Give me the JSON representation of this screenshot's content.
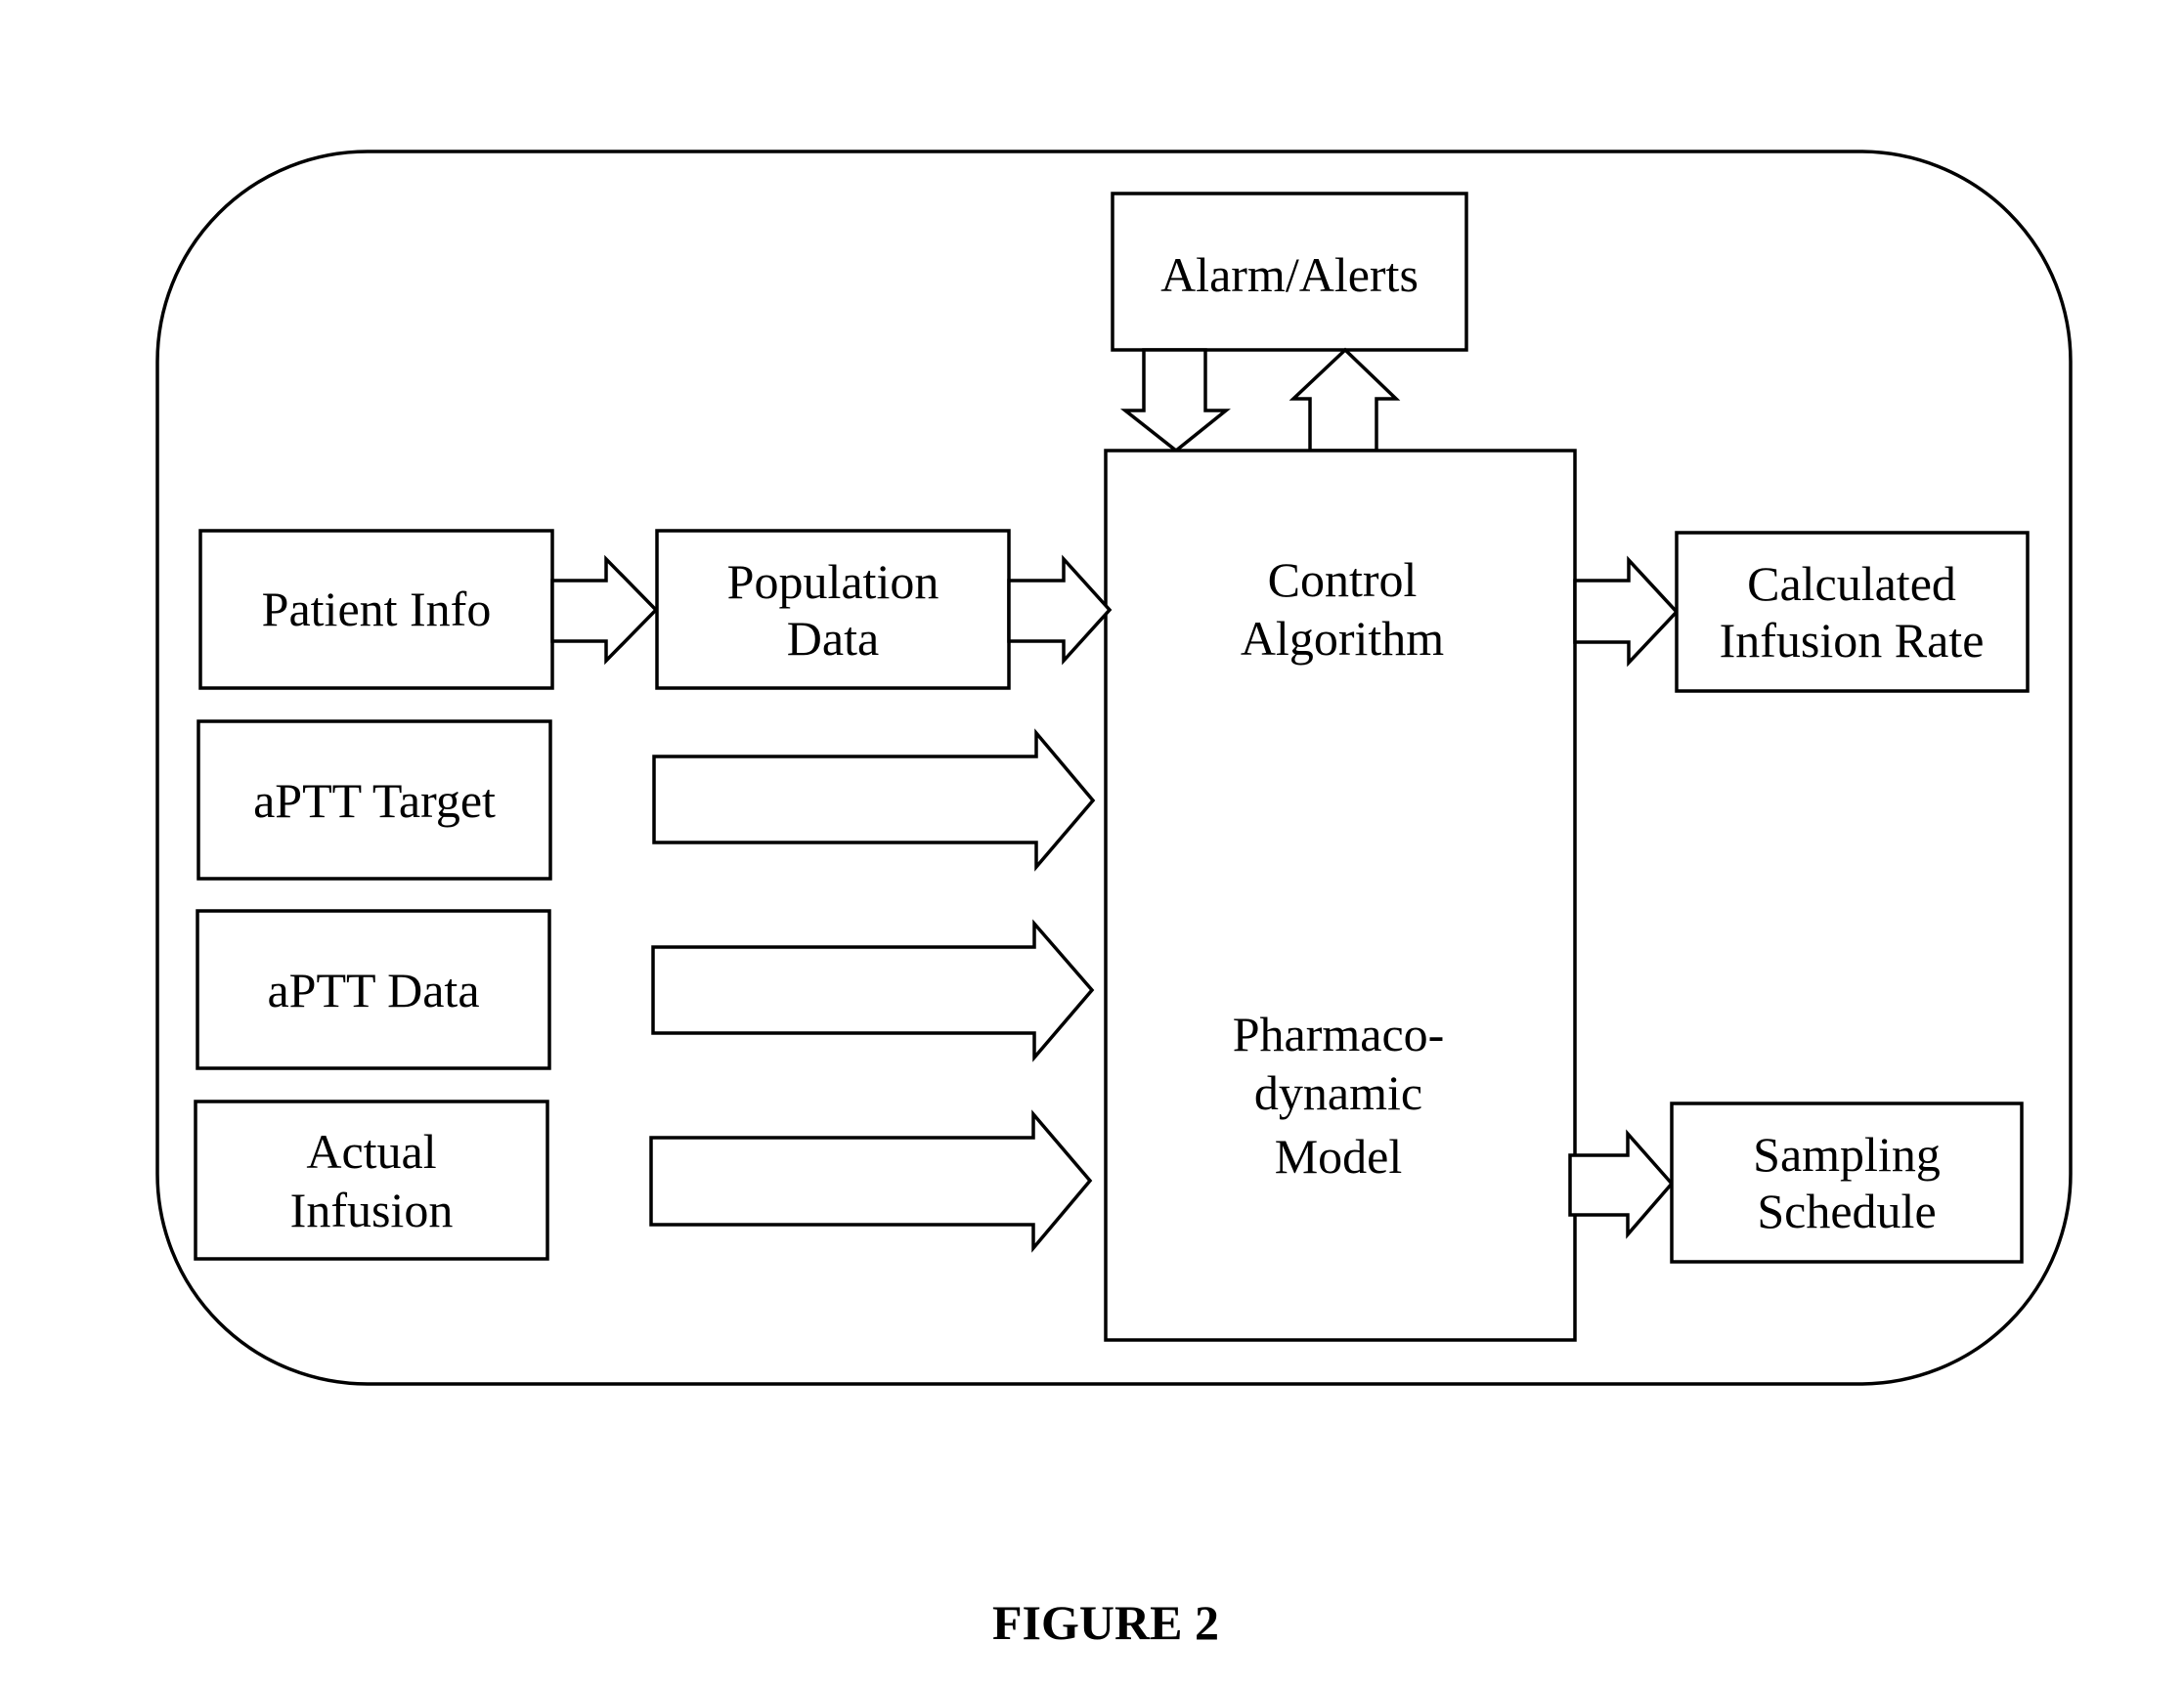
{
  "figure": {
    "caption": "FIGURE 2",
    "colors": {
      "stroke": "#000000",
      "background": "#ffffff"
    }
  },
  "nodes": {
    "alarm": {
      "lines": [
        "Alarm/Alerts"
      ]
    },
    "patient_info": {
      "lines": [
        "Patient Info"
      ]
    },
    "population_data": {
      "lines": [
        "Population",
        "Data"
      ]
    },
    "aptt_target": {
      "lines": [
        "aPTT Target"
      ]
    },
    "aptt_data": {
      "lines": [
        "aPTT Data"
      ]
    },
    "actual_infusion": {
      "lines": [
        "Actual",
        "Infusion"
      ]
    },
    "control_algorithm": {
      "lines": [
        "Control",
        "Algorithm"
      ]
    },
    "pd_model": {
      "lines": [
        "Pharmaco-",
        "dynamic",
        "Model"
      ]
    },
    "calculated_infusion_rate": {
      "lines": [
        "Calculated",
        "Infusion Rate"
      ]
    },
    "sampling_schedule": {
      "lines": [
        "Sampling",
        "Schedule"
      ]
    }
  },
  "edges": [
    {
      "from": "patient_info",
      "to": "population_data"
    },
    {
      "from": "population_data",
      "to": "control_algorithm"
    },
    {
      "from": "aptt_target",
      "to": "control_algorithm"
    },
    {
      "from": "aptt_data",
      "to": "control_algorithm"
    },
    {
      "from": "actual_infusion",
      "to": "control_algorithm"
    },
    {
      "from": "alarm",
      "to": "control_algorithm"
    },
    {
      "from": "control_algorithm",
      "to": "alarm"
    },
    {
      "from": "control_algorithm",
      "to": "calculated_infusion_rate"
    },
    {
      "from": "pd_model",
      "to": "sampling_schedule"
    }
  ]
}
